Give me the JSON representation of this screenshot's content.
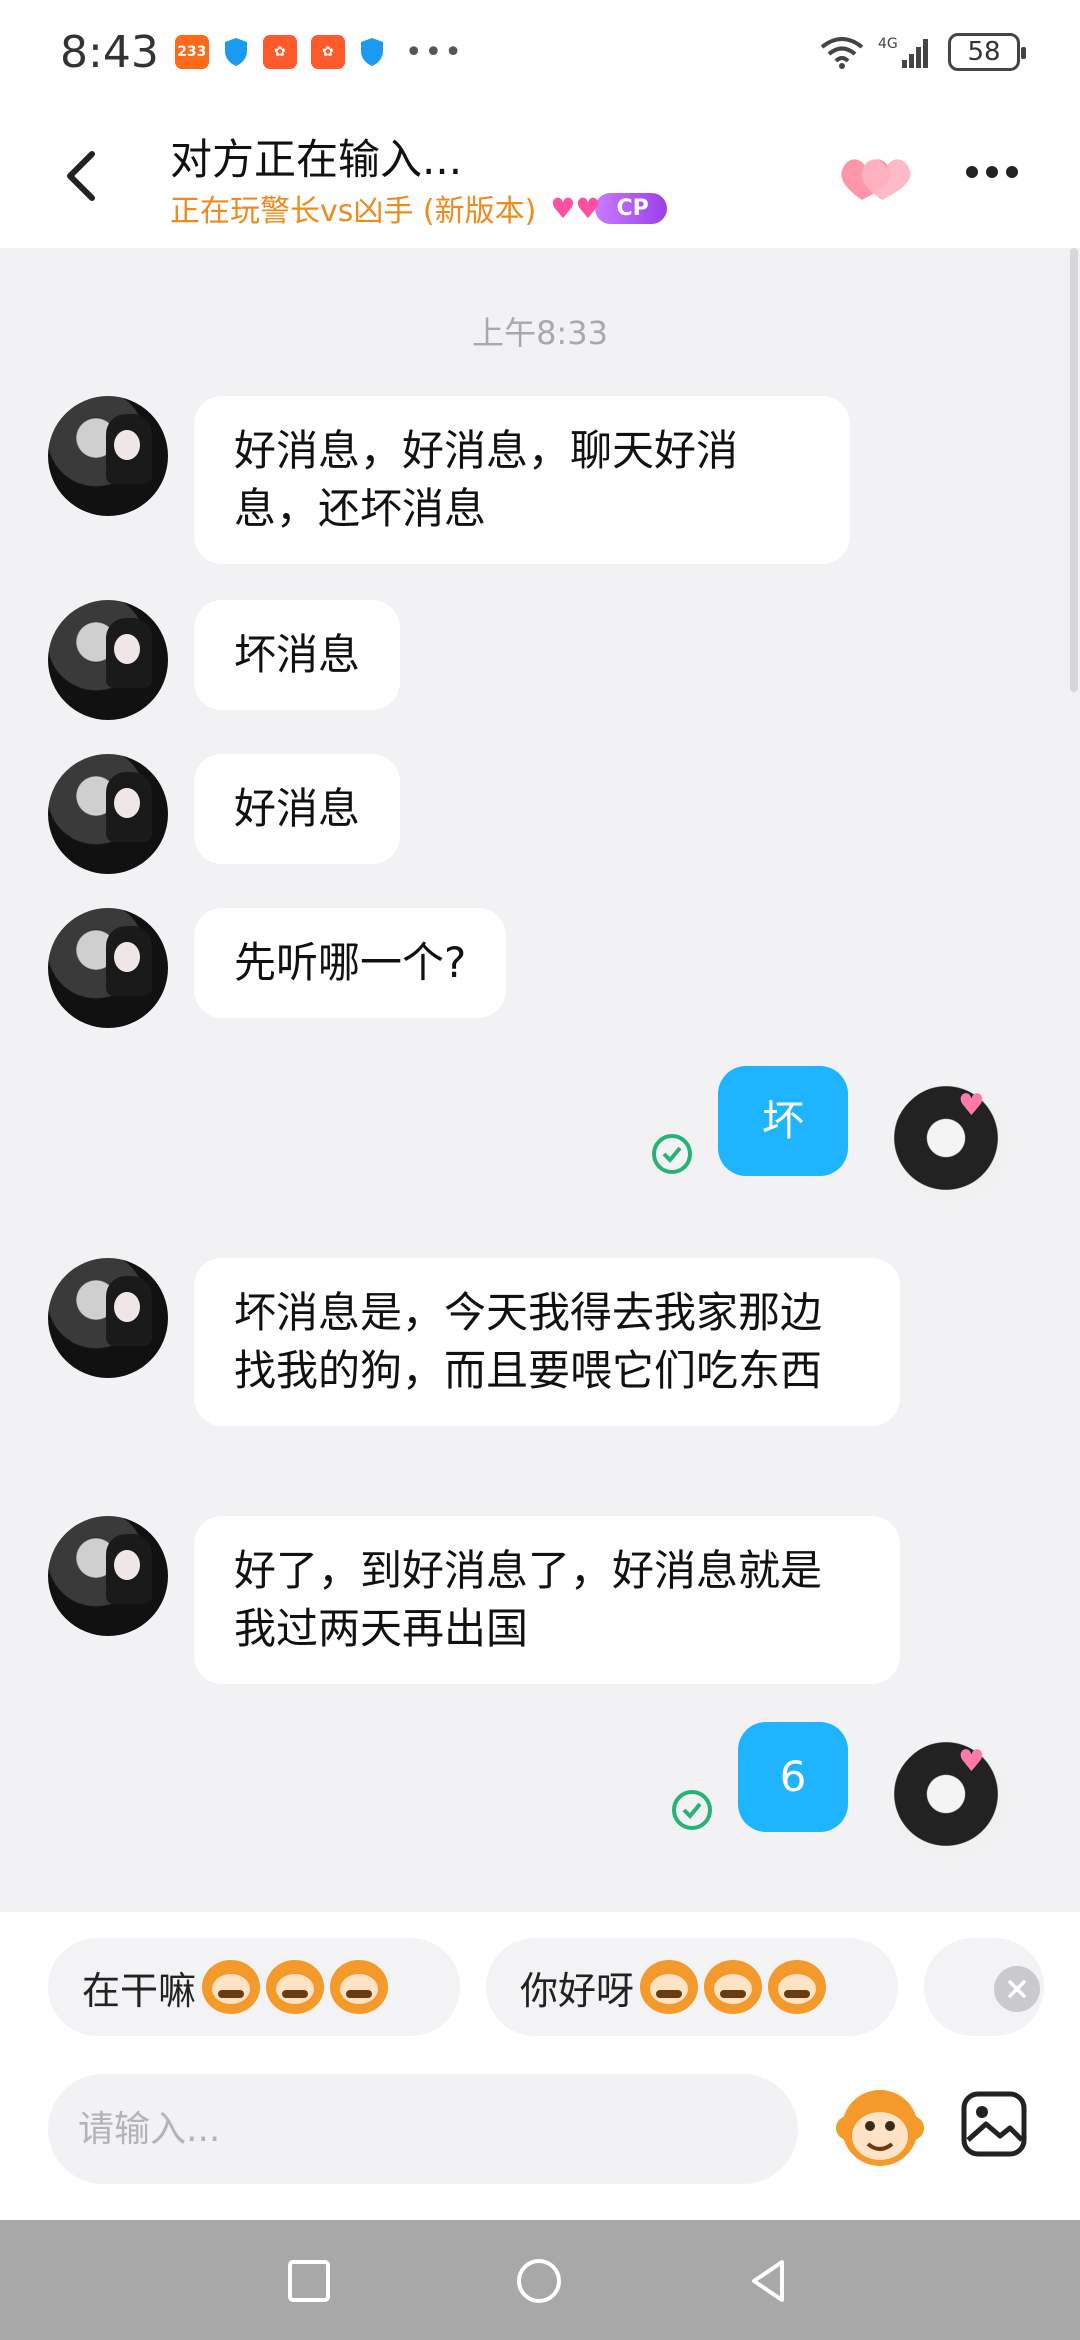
{
  "status_bar": {
    "time": "8:43",
    "badge_233": "233",
    "battery": "58",
    "network": "4G"
  },
  "header": {
    "title": "对方正在输入...",
    "subtitle": "正在玩警长vs凶手 (新版本)",
    "cp_label": "CP"
  },
  "chat": {
    "timestamp": "上午8:33",
    "messages": [
      {
        "side": "left",
        "text": "好消息，好消息，聊天好消息，还坏消息"
      },
      {
        "side": "left",
        "text": "坏消息"
      },
      {
        "side": "left",
        "text": "好消息"
      },
      {
        "side": "left",
        "text": "先听哪一个?"
      },
      {
        "side": "right",
        "text": "坏",
        "read": true
      },
      {
        "side": "left",
        "text": "坏消息是，今天我得去我家那边找我的狗，而且要喂它们吃东西"
      },
      {
        "side": "left",
        "text": "好了，到好消息了，好消息就是我过两天再出国"
      },
      {
        "side": "right",
        "text": "6",
        "read": true
      }
    ]
  },
  "quick_replies": [
    {
      "label": "在干嘛",
      "emoji": "monkey-grin-icon"
    },
    {
      "label": "你好呀",
      "emoji": "monkey-smile-icon"
    }
  ],
  "input": {
    "placeholder": "请输入..."
  },
  "colors": {
    "accent_blue": "#1fb4ff",
    "subtitle_orange": "#f08a1c",
    "read_green": "#27b377",
    "cp_purple": "#9b3fe8"
  }
}
